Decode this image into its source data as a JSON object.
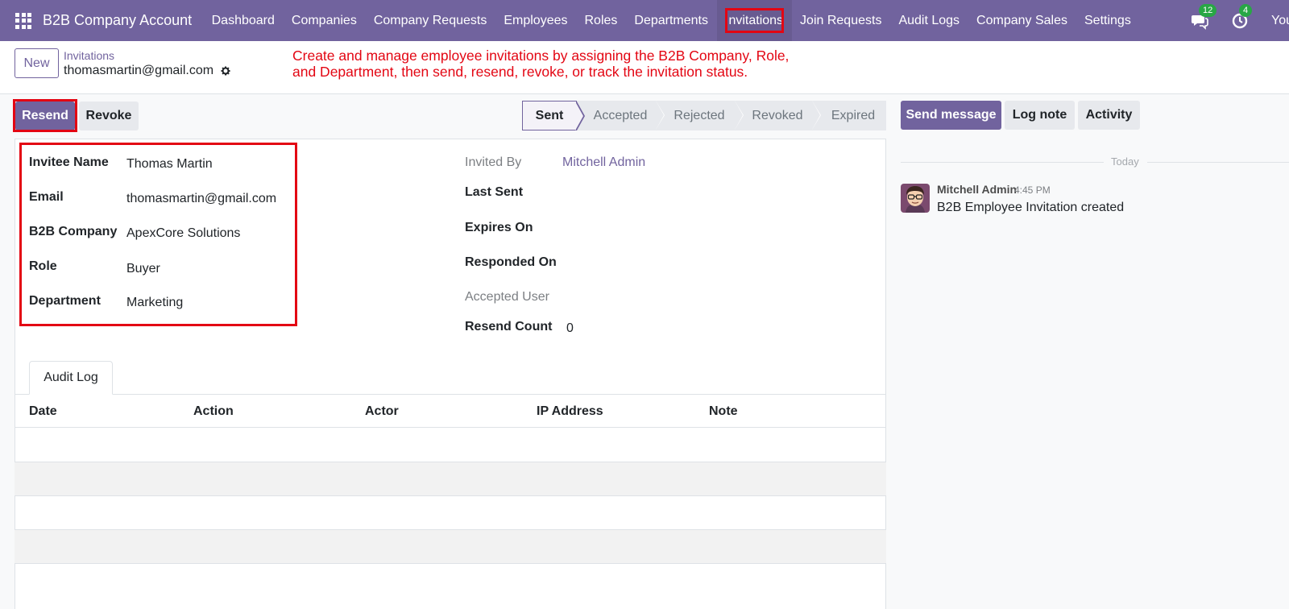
{
  "navbar": {
    "app_title": "B2B Company Account",
    "menu": [
      "Dashboard",
      "Companies",
      "Company Requests",
      "Employees",
      "Roles",
      "Departments",
      "Invitations",
      "Join Requests",
      "Audit Logs",
      "Company Sales",
      "Settings"
    ],
    "active_item": "Invitations",
    "messages_badge": "12",
    "activities_badge": "4",
    "user_name": "You",
    "accent_color": "#71639e"
  },
  "control_panel": {
    "new_label": "New",
    "breadcrumb_parent": "Invitations",
    "breadcrumb_current": "thomasmartin@gmail.com"
  },
  "annotation": {
    "line1": "Create and manage employee invitations by assigning the B2B Company, Role,",
    "line2": "and Department, then send, resend, revoke, or track the invitation status.",
    "color": "#e30613"
  },
  "actions": {
    "resend": "Resend",
    "revoke": "Revoke"
  },
  "statusbar": {
    "stages": [
      "Sent",
      "Accepted",
      "Rejected",
      "Revoked",
      "Expired"
    ],
    "current": "Sent"
  },
  "chatter_buttons": {
    "send_message": "Send message",
    "log_note": "Log note",
    "activity": "Activity"
  },
  "form": {
    "left": [
      {
        "label": "Invitee Name",
        "value": "Thomas Martin"
      },
      {
        "label": "Email",
        "value": "thomasmartin@gmail.com"
      },
      {
        "label": "B2B Company",
        "value": "ApexCore Solutions"
      },
      {
        "label": "Role",
        "value": "Buyer"
      },
      {
        "label": "Department",
        "value": "Marketing"
      }
    ],
    "right": [
      {
        "label": "Invited By",
        "value": "Mitchell Admin"
      },
      {
        "label": "Last Sent",
        "value": ""
      },
      {
        "label": "Expires On",
        "value": ""
      },
      {
        "label": "Responded On",
        "value": ""
      },
      {
        "label": "Accepted User",
        "value": ""
      },
      {
        "label": "Resend Count",
        "value": "0"
      }
    ]
  },
  "tabs": {
    "audit_log": "Audit Log"
  },
  "audit_table": {
    "columns": [
      "Date",
      "Action",
      "Actor",
      "IP Address",
      "Note"
    ]
  },
  "chatter": {
    "date_separator": "Today",
    "message": {
      "author": "Mitchell Admin",
      "time": "4:45 PM",
      "body": "B2B Employee Invitation created"
    }
  }
}
